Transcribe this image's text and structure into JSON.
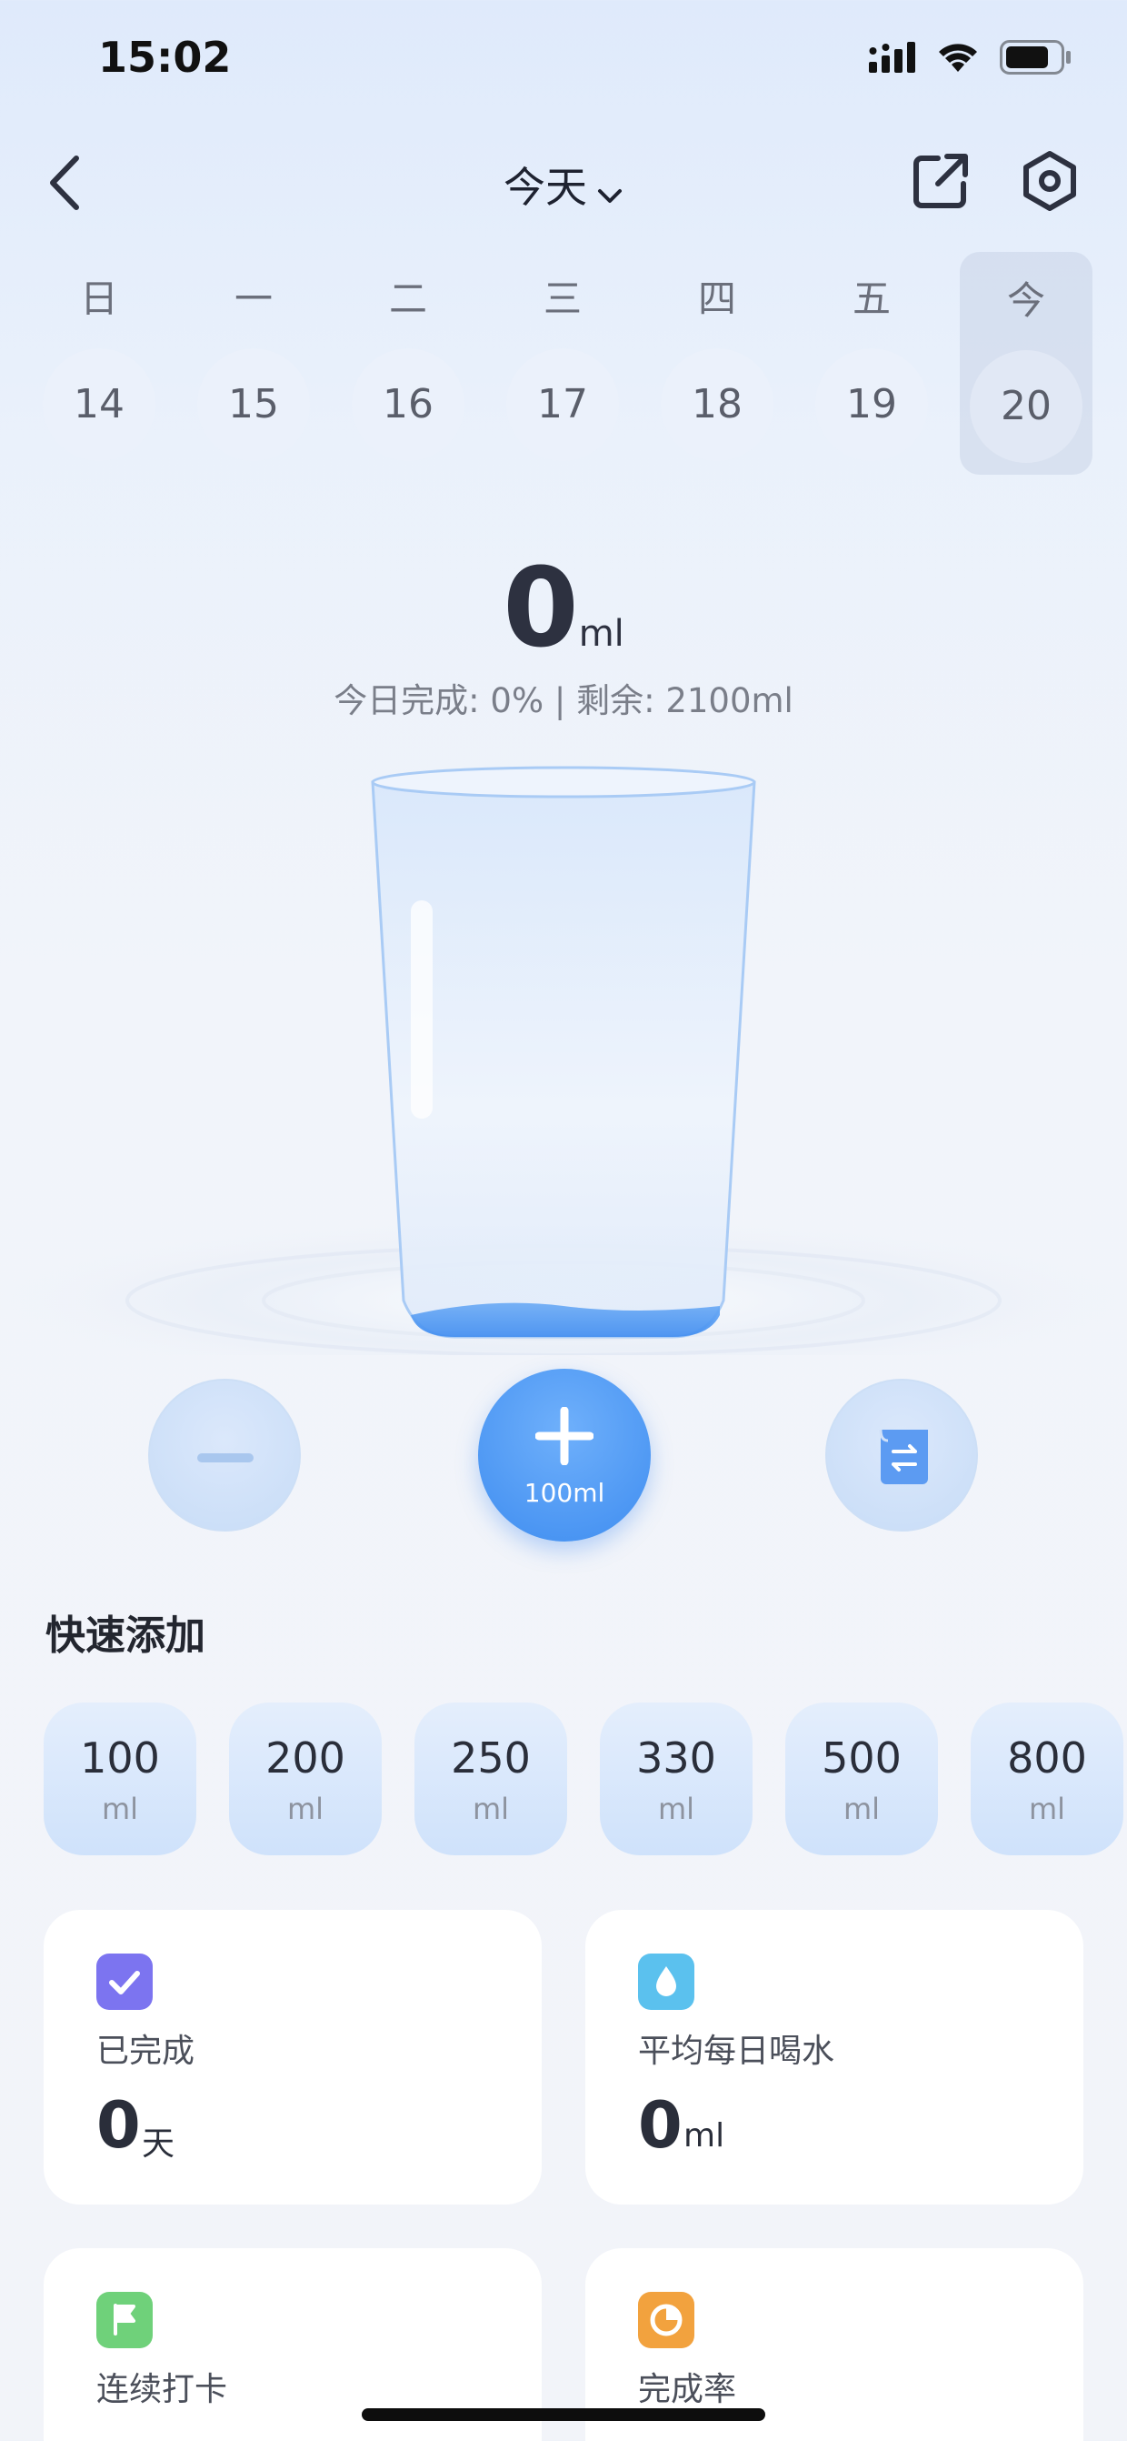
{
  "status_bar": {
    "time": "15:02"
  },
  "nav": {
    "title": "今天"
  },
  "week": {
    "days": [
      {
        "weekday": "日",
        "date": "14"
      },
      {
        "weekday": "一",
        "date": "15"
      },
      {
        "weekday": "二",
        "date": "16"
      },
      {
        "weekday": "三",
        "date": "17"
      },
      {
        "weekday": "四",
        "date": "18"
      },
      {
        "weekday": "五",
        "date": "19"
      },
      {
        "weekday": "今",
        "date": "20"
      }
    ]
  },
  "intake": {
    "value": "0",
    "unit": "ml",
    "summary": "今日完成: 0% | 剩余: 2100ml",
    "fill_fraction": 0
  },
  "controls": {
    "add_label": "100ml"
  },
  "quick_add": {
    "title": "快速添加",
    "items": [
      {
        "amount": "100",
        "unit": "ml"
      },
      {
        "amount": "200",
        "unit": "ml"
      },
      {
        "amount": "250",
        "unit": "ml"
      },
      {
        "amount": "330",
        "unit": "ml"
      },
      {
        "amount": "500",
        "unit": "ml"
      },
      {
        "amount": "800",
        "unit": "ml"
      }
    ]
  },
  "stats": {
    "completed": {
      "label": "已完成",
      "value": "0",
      "unit": "天",
      "color": "#7c74f0"
    },
    "average": {
      "label": "平均每日喝水",
      "value": "0",
      "unit": "ml",
      "color": "#5bc1ee"
    },
    "streak": {
      "label": "连续打卡",
      "color": "#6fd17a"
    },
    "rate": {
      "label": "完成率",
      "color": "#f2a23e"
    }
  },
  "colors": {
    "accent": "#4a95f3",
    "water": "#4a95f3"
  }
}
